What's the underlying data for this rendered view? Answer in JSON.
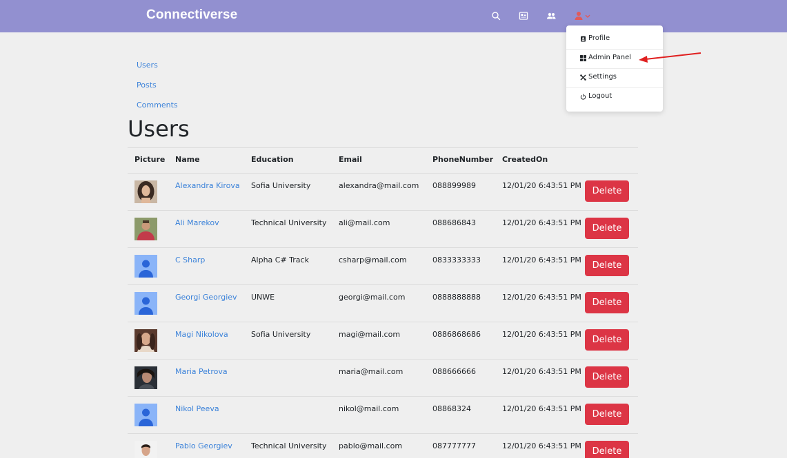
{
  "navbar": {
    "brand": "Connectiverse",
    "icons": [
      "search-icon",
      "newspaper-icon",
      "users-icon",
      "user-menu-icon"
    ]
  },
  "dropdown": {
    "items": [
      {
        "label": "Profile",
        "icon": "profile-icon"
      },
      {
        "label": "Admin Panel",
        "icon": "grid-icon"
      },
      {
        "label": "Settings",
        "icon": "tools-icon"
      },
      {
        "label": "Logout",
        "icon": "power-icon"
      }
    ]
  },
  "sidebar": {
    "links": [
      "Users",
      "Posts",
      "Comments"
    ]
  },
  "page": {
    "title": "Users"
  },
  "table": {
    "headers": [
      "Picture",
      "Name",
      "Education",
      "Email",
      "PhoneNumber",
      "CreatedOn"
    ],
    "rows": [
      {
        "avatar": "photo-woman-dark-hair",
        "name": "Alexandra Kirova",
        "education": "Sofia University",
        "email": "alexandra@mail.com",
        "phone": "088899989",
        "created": "12/01/20 6:43:51 PM",
        "action": "Delete"
      },
      {
        "avatar": "photo-man-red-shirt",
        "name": "Ali Marekov",
        "education": "Technical University",
        "email": "ali@mail.com",
        "phone": "088686843",
        "created": "12/01/20 6:43:51 PM",
        "action": "Delete"
      },
      {
        "avatar": "default-avatar",
        "name": "C Sharp",
        "education": "Alpha C# Track",
        "email": "csharp@mail.com",
        "phone": "0833333333",
        "created": "12/01/20 6:43:51 PM",
        "action": "Delete"
      },
      {
        "avatar": "default-avatar",
        "name": "Georgi Georgiev",
        "education": "UNWE",
        "email": "georgi@mail.com",
        "phone": "0888888888",
        "created": "12/01/20 6:43:51 PM",
        "action": "Delete"
      },
      {
        "avatar": "photo-woman-curly-hair",
        "name": "Magi Nikolova",
        "education": "Sofia University",
        "email": "magi@mail.com",
        "phone": "0886868686",
        "created": "12/01/20 6:43:51 PM",
        "action": "Delete"
      },
      {
        "avatar": "photo-woman-dark",
        "name": "Maria Petrova",
        "education": "",
        "email": "maria@mail.com",
        "phone": "088666666",
        "created": "12/01/20 6:43:51 PM",
        "action": "Delete"
      },
      {
        "avatar": "default-avatar",
        "name": "Nikol Peeva",
        "education": "",
        "email": "nikol@mail.com",
        "phone": "08868324",
        "created": "12/01/20 6:43:51 PM",
        "action": "Delete"
      },
      {
        "avatar": "photo-man-portrait",
        "name": "Pablo Georgiev",
        "education": "Technical University",
        "email": "pablo@mail.com",
        "phone": "087777777",
        "created": "12/01/20 6:43:51 PM",
        "action": "Delete"
      }
    ]
  },
  "colors": {
    "navbar": "#9290d0",
    "link": "#3b82d9",
    "danger": "#dc3545",
    "background": "#efefef",
    "avatar_default": "#8ab4f8"
  }
}
